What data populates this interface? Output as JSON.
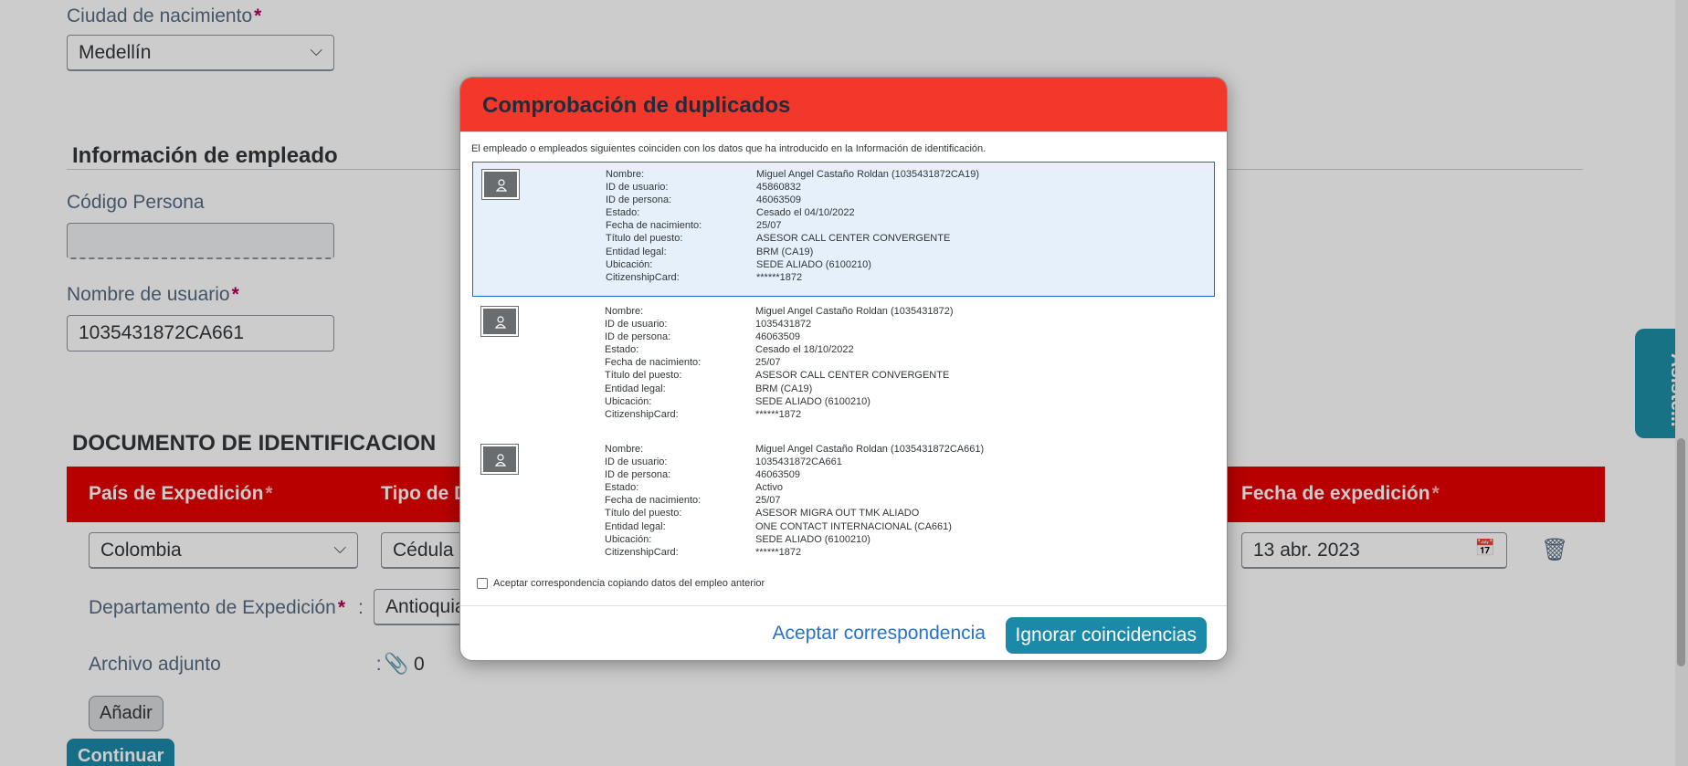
{
  "page": {
    "birth_city": {
      "label": "Ciudad de nacimiento",
      "value": "Medellín"
    },
    "employee_section": {
      "title": "Información de empleado"
    },
    "person_code": {
      "label": "Código Persona",
      "value": ""
    },
    "username": {
      "label": "Nombre de usuario",
      "value": "1035431872CA661"
    },
    "id_doc_section": {
      "title": "DOCUMENTO DE IDENTIFICACION"
    },
    "table_headers": {
      "country": "País de Expedición",
      "type": "Tipo de D",
      "issue_date": "Fecha de expedición"
    },
    "row": {
      "country": "Colombia",
      "doc_type": "Cédula d",
      "issue_date": "13 abr. 2023"
    },
    "department": {
      "label": "Departamento de Expedición",
      "value": "Antioquia"
    },
    "attachment": {
      "label": "Archivo adjunto",
      "count": "0"
    },
    "add_button": "Añadir",
    "continue_button": "Continuar",
    "assistant_tab": "Asiste..."
  },
  "dialog": {
    "title": "Comprobación de duplicados",
    "intro": "El empleado o empleados siguientes coinciden con los datos que ha introducido en la Información de identificación.",
    "labels": {
      "name": "Nombre:",
      "user_id": "ID de usuario:",
      "person_id": "ID de persona:",
      "status": "Estado:",
      "birth_date": "Fecha de nacimiento:",
      "job_title": "Título del puesto:",
      "legal_entity": "Entidad legal:",
      "location": "Ubicación:",
      "citizenship": "CitizenshipCard:"
    },
    "matches": [
      {
        "name": "Miguel Angel Castaño Roldan (1035431872CA19)",
        "user_id": "45860832",
        "person_id": "46063509",
        "status": "Cesado el 04/10/2022",
        "birth_date": "25/07",
        "job_title": "ASESOR CALL CENTER CONVERGENTE",
        "legal_entity": "BRM (CA19)",
        "location": "SEDE ALIADO (6100210)",
        "citizenship": "******1872"
      },
      {
        "name": "Miguel Angel Castaño Roldan (1035431872)",
        "user_id": "1035431872",
        "person_id": "46063509",
        "status": "Cesado el 18/10/2022",
        "birth_date": "25/07",
        "job_title": "ASESOR CALL CENTER CONVERGENTE",
        "legal_entity": "BRM (CA19)",
        "location": "SEDE ALIADO (6100210)",
        "citizenship": "******1872"
      },
      {
        "name": "Miguel Angel Castaño Roldan (1035431872CA661)",
        "user_id": "1035431872CA661",
        "person_id": "46063509",
        "status": "Activo",
        "birth_date": "25/07",
        "job_title": "ASESOR MIGRA OUT TMK ALIADO",
        "legal_entity": "ONE CONTACT INTERNACIONAL (CA661)",
        "location": "SEDE ALIADO (6100210)",
        "citizenship": "******1872"
      }
    ],
    "checkbox_label": "Aceptar correspondencia copiando datos del empleo anterior",
    "accept_button": "Aceptar correspondencia",
    "ignore_button": "Ignorar coincidencias"
  }
}
